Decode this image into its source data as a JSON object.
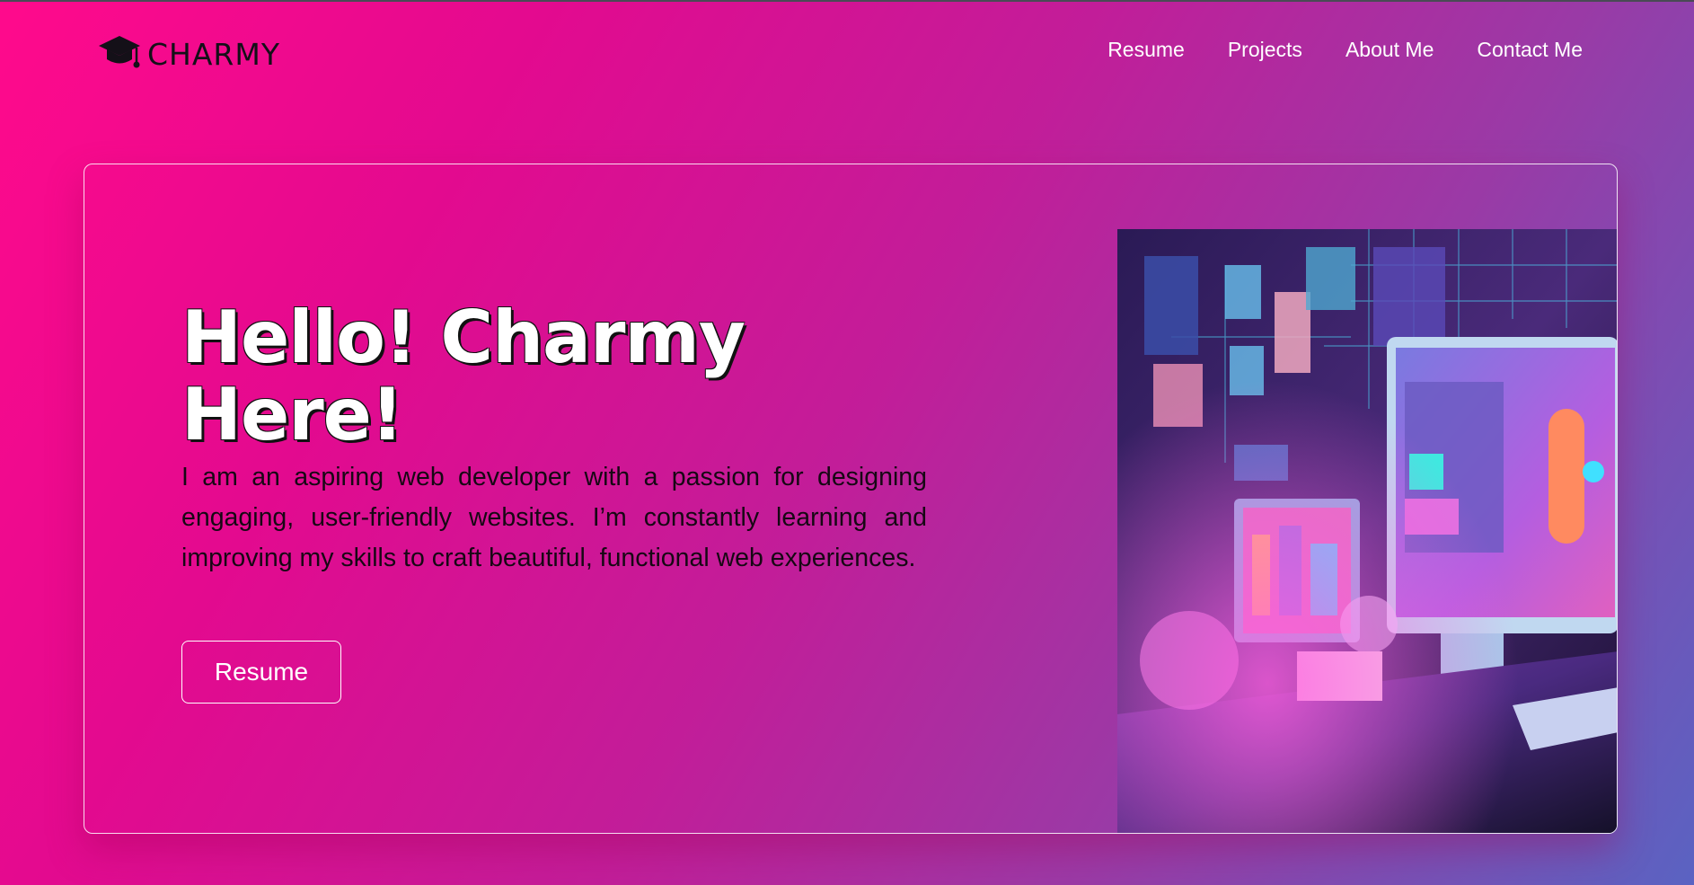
{
  "brand": {
    "name": "CHARMY",
    "icon": "graduation-cap-icon"
  },
  "nav": {
    "items": [
      {
        "label": "Resume"
      },
      {
        "label": "Projects"
      },
      {
        "label": "About Me"
      },
      {
        "label": "Contact Me"
      }
    ]
  },
  "hero": {
    "headline_line1": "Hello! Charmy",
    "headline_line2": "Here!",
    "intro": "I am an aspiring web developer with a passion for designing engaging, user-friendly websites. I’m constantly learning and improving my skills to craft beautiful, functional web experiences.",
    "cta_label": "Resume",
    "image_icon": "workspace-illustration-icon"
  },
  "colors": {
    "accent_pink": "#ff0a8c",
    "accent_blue": "#5a63c2",
    "text_white": "#ffffff",
    "text_dark": "#160814"
  }
}
